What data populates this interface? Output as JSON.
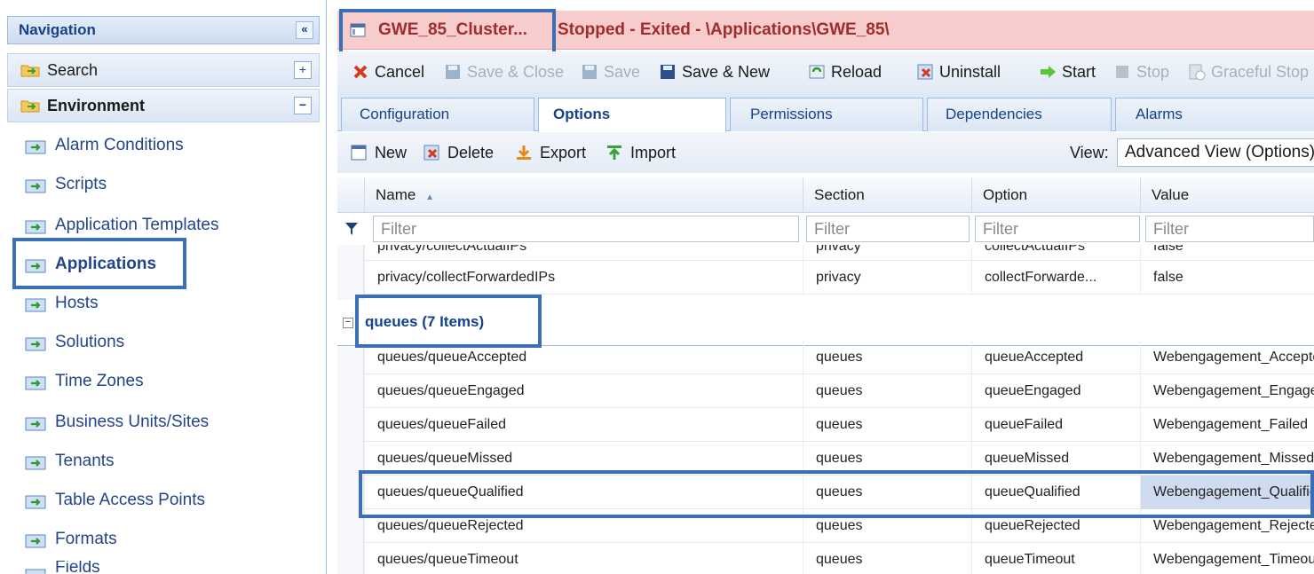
{
  "nav": {
    "title": "Navigation",
    "collapse_glyph": "«",
    "search_label": "Search",
    "environment_label": "Environment",
    "items": [
      {
        "label": "Alarm Conditions"
      },
      {
        "label": "Scripts"
      },
      {
        "label": "Application Templates"
      },
      {
        "label": "Applications"
      },
      {
        "label": "Hosts"
      },
      {
        "label": "Solutions"
      },
      {
        "label": "Time Zones"
      },
      {
        "label": "Business Units/Sites"
      },
      {
        "label": "Tenants"
      },
      {
        "label": "Table Access Points"
      },
      {
        "label": "Formats"
      },
      {
        "label": "Fields"
      }
    ],
    "active_item": "Applications"
  },
  "header": {
    "app_name": "GWE_85_Cluster...",
    "status": "Stopped - Exited - \\Applications\\GWE_85\\"
  },
  "toolbar": {
    "cancel": "Cancel",
    "save_close": "Save & Close",
    "save": "Save",
    "save_new": "Save & New",
    "reload": "Reload",
    "uninstall": "Uninstall",
    "start": "Start",
    "stop": "Stop",
    "graceful_stop": "Graceful Stop"
  },
  "tabs": [
    {
      "label": "Configuration"
    },
    {
      "label": "Options"
    },
    {
      "label": "Permissions"
    },
    {
      "label": "Dependencies"
    },
    {
      "label": "Alarms"
    }
  ],
  "active_tab": "Options",
  "grid_toolbar": {
    "new": "New",
    "delete": "Delete",
    "export": "Export",
    "import": "Import",
    "view_label": "View:",
    "view_value": "Advanced View (Options)"
  },
  "grid": {
    "columns": [
      "Name",
      "Section",
      "Option",
      "Value"
    ],
    "sort_indicator": "▲",
    "filter_placeholder": "Filter",
    "top_rows": [
      {
        "name": "privacy/collectActualIPs",
        "section": "privacy",
        "option": "collectActualIPs",
        "value": "false"
      },
      {
        "name": "privacy/collectForwardedIPs",
        "section": "privacy",
        "option": "collectForwarde...",
        "value": "false"
      }
    ],
    "group_label": "queues (7 Items)",
    "group_rows": [
      {
        "name": "queues/queueAccepted",
        "section": "queues",
        "option": "queueAccepted",
        "value": "Webengagement_Accepted"
      },
      {
        "name": "queues/queueEngaged",
        "section": "queues",
        "option": "queueEngaged",
        "value": "Webengagement_Engaged"
      },
      {
        "name": "queues/queueFailed",
        "section": "queues",
        "option": "queueFailed",
        "value": "Webengagement_Failed"
      },
      {
        "name": "queues/queueMissed",
        "section": "queues",
        "option": "queueMissed",
        "value": "Webengagement_Missed"
      },
      {
        "name": "queues/queueQualified",
        "section": "queues",
        "option": "queueQualified",
        "value": "Webengagement_Qualified"
      },
      {
        "name": "queues/queueRejected",
        "section": "queues",
        "option": "queueRejected",
        "value": "Webengagement_Rejected"
      },
      {
        "name": "queues/queueTimeout",
        "section": "queues",
        "option": "queueTimeout",
        "value": "Webengagement_Timeout"
      }
    ],
    "selected_row": "queues/queueQualified"
  },
  "colors": {
    "highlight": "#3a6fb6",
    "title_bg": "#f7cccc",
    "title_text": "#a12c2c",
    "nav_text": "#23448c"
  }
}
